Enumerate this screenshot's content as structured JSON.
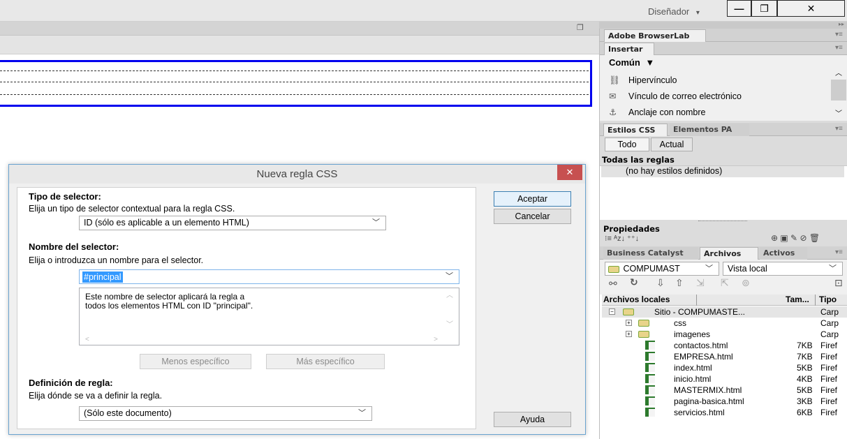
{
  "topbar": {
    "workspace_label": "Diseñador",
    "workspace_chevron": "▾",
    "minimize_glyph": "—",
    "restore_glyph": "❐",
    "close_glyph": "✕"
  },
  "document": {
    "restore_glyph": "❐"
  },
  "dialog": {
    "title": "Nueva regla CSS",
    "close_glyph": "✕",
    "selector_type": {
      "heading": "Tipo de selector:",
      "hint": "Elija un tipo de selector contextual para la regla CSS.",
      "value": "ID (sólo es aplicable a un elemento HTML)"
    },
    "selector_name": {
      "heading": "Nombre del selector:",
      "hint": "Elija o introduzca un nombre para el selector.",
      "value": "#principal",
      "description_line1": "Este nombre de selector aplicará la regla a",
      "description_line2": "todos los elementos HTML con ID \"principal\".",
      "less_specific": "Menos específico",
      "more_specific": "Más específico"
    },
    "rule_definition": {
      "heading": "Definición de regla:",
      "hint": "Elija dónde se va a definir la regla.",
      "value": "(Sólo este documento)"
    },
    "buttons": {
      "ok": "Aceptar",
      "cancel": "Cancelar",
      "help": "Ayuda"
    }
  },
  "panels": {
    "browserlab_tab": "Adobe BrowserLab",
    "insert_tab": "Insertar",
    "insert_category": "Común",
    "insert_items": [
      {
        "label": "Hipervínculo",
        "icon": "hyperlink-icon"
      },
      {
        "label": "Vínculo de correo electrónico",
        "icon": "email-link-icon"
      },
      {
        "label": "Anclaje con nombre",
        "icon": "anchor-icon"
      }
    ],
    "css_tabs": {
      "styles": "Estilos CSS",
      "ap": "Elementos PA"
    },
    "css_modes": {
      "all": "Todo",
      "current": "Actual"
    },
    "all_rules_title": "Todas las reglas",
    "no_styles": "(no hay estilos definidos)",
    "properties_title": "Propiedades",
    "files_tabs": {
      "bc": "Business Catalyst",
      "files": "Archivos",
      "assets": "Activos"
    },
    "site_select": "COMPUMAST",
    "view_select": "Vista local",
    "files_header": {
      "name": "Archivos locales",
      "size": "Tam...",
      "type": "Tipo"
    },
    "site_root": {
      "name": "Sitio - COMPUMASTE...",
      "type": "Carp"
    },
    "files": [
      {
        "name": "css",
        "size": "",
        "type": "Carp",
        "folder": true
      },
      {
        "name": "imagenes",
        "size": "",
        "type": "Carp",
        "folder": true
      },
      {
        "name": "contactos.html",
        "size": "7KB",
        "type": "Firef",
        "folder": false
      },
      {
        "name": "EMPRESA.html",
        "size": "7KB",
        "type": "Firef",
        "folder": false
      },
      {
        "name": "index.html",
        "size": "5KB",
        "type": "Firef",
        "folder": false
      },
      {
        "name": "inicio.html",
        "size": "4KB",
        "type": "Firef",
        "folder": false
      },
      {
        "name": "MASTERMIX.html",
        "size": "5KB",
        "type": "Firef",
        "folder": false
      },
      {
        "name": "pagina-basica.html",
        "size": "3KB",
        "type": "Firef",
        "folder": false
      },
      {
        "name": "servicios.html",
        "size": "6KB",
        "type": "Firef",
        "folder": false
      }
    ]
  }
}
